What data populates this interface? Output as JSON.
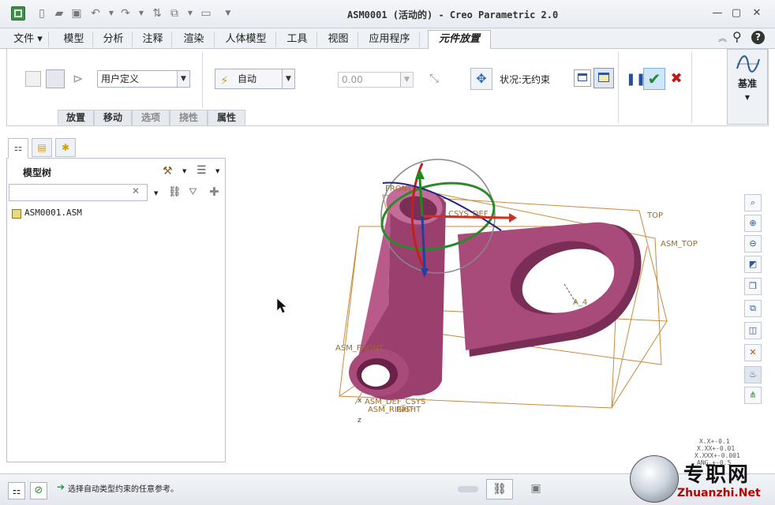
{
  "window": {
    "title": "ASM0001 (活动的) - Creo Parametric 2.0"
  },
  "menu": {
    "tabs": [
      "文件 ▾",
      "模型",
      "分析",
      "注释",
      "渲染",
      "人体模型",
      "工具",
      "视图",
      "应用程序"
    ],
    "active_tab": "元件放置"
  },
  "ribbon": {
    "constraint_set": "用户定义",
    "constraint_type": "自动",
    "offset_value": "0.00",
    "status_label": "状况:无约束",
    "datum_label": "基准",
    "subtabs": [
      "放置",
      "移动",
      "选项",
      "挠性",
      "属性"
    ]
  },
  "model_tree": {
    "title": "模型树",
    "search_placeholder": "",
    "items": [
      "ASM0001.ASM"
    ]
  },
  "viewport": {
    "labels": {
      "front": "FRONT",
      "top": "TOP",
      "asm_top": "ASM_TOP",
      "axis": "A_4",
      "asm_front": "ASM_FRONT",
      "asm_def_csys": "ASM_DEF_CSYS",
      "asm_right": "ASM_RIGHT",
      "right": "RIGHT",
      "csys_def": "CSYS_DEF",
      "axis_z": "z",
      "axis_x": "x"
    },
    "tolerance": [
      "X.X+-0.1",
      "X.XX+-0.01",
      "X.XXX+-0.001",
      "ANG.+-0.5"
    ]
  },
  "statusbar": {
    "message": "选择自动类型约束的任意参考。"
  },
  "watermark": {
    "cn": "专职网",
    "url": "Zhuanzhi.Net"
  },
  "colors": {
    "part": "#a84a7a",
    "part_dark": "#7a2e56",
    "part_light": "#c46c98",
    "datum": "#c98a3c",
    "accent": "#2a6ac0"
  }
}
